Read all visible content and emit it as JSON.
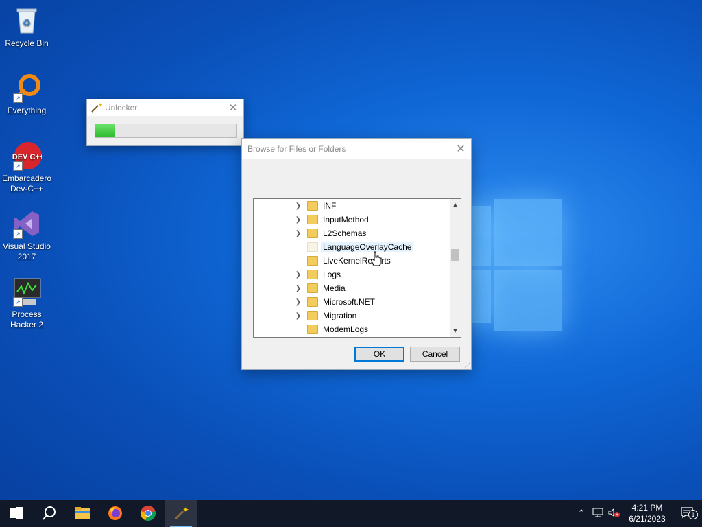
{
  "desktop": {
    "icons": [
      {
        "label": "Recycle Bin",
        "icon": "recycle-bin-icon"
      },
      {
        "label": "Everything",
        "icon": "everything-search-icon"
      },
      {
        "label": "Embarcadero Dev-C++",
        "icon": "devcpp-icon",
        "glyph": "DEV C++"
      },
      {
        "label": "Visual Studio 2017",
        "icon": "visual-studio-icon"
      },
      {
        "label": "Process Hacker 2",
        "icon": "process-hacker-icon"
      }
    ]
  },
  "unlocker": {
    "title": "Unlocker",
    "close_glyph": "✕",
    "progress_percent": 14
  },
  "browse_dialog": {
    "title": "Browse for Files or Folders",
    "close_glyph": "✕",
    "tree_items": [
      {
        "label": "INF",
        "expandable": true
      },
      {
        "label": "InputMethod",
        "expandable": true
      },
      {
        "label": "L2Schemas",
        "expandable": true
      },
      {
        "label": "LanguageOverlayCache",
        "expandable": false,
        "hovered": true
      },
      {
        "label": "LiveKernelReports",
        "expandable": false
      },
      {
        "label": "Logs",
        "expandable": true
      },
      {
        "label": "Media",
        "expandable": true
      },
      {
        "label": "Microsoft.NET",
        "expandable": true
      },
      {
        "label": "Migration",
        "expandable": true
      },
      {
        "label": "ModemLogs",
        "expandable": false
      }
    ],
    "ok_label": "OK",
    "cancel_label": "Cancel"
  },
  "taskbar": {
    "items": [
      "start-icon",
      "search-icon",
      "file-explorer-icon",
      "firefox-icon",
      "chrome-icon",
      "unlocker-icon"
    ],
    "active_item": "unlocker-icon",
    "tray": {
      "time": "4:21 PM",
      "date": "6/21/2023",
      "notification_count": "1"
    }
  },
  "colors": {
    "accent": "#0078d7",
    "progress": "#2dbb2d",
    "taskbar": "#111827"
  }
}
